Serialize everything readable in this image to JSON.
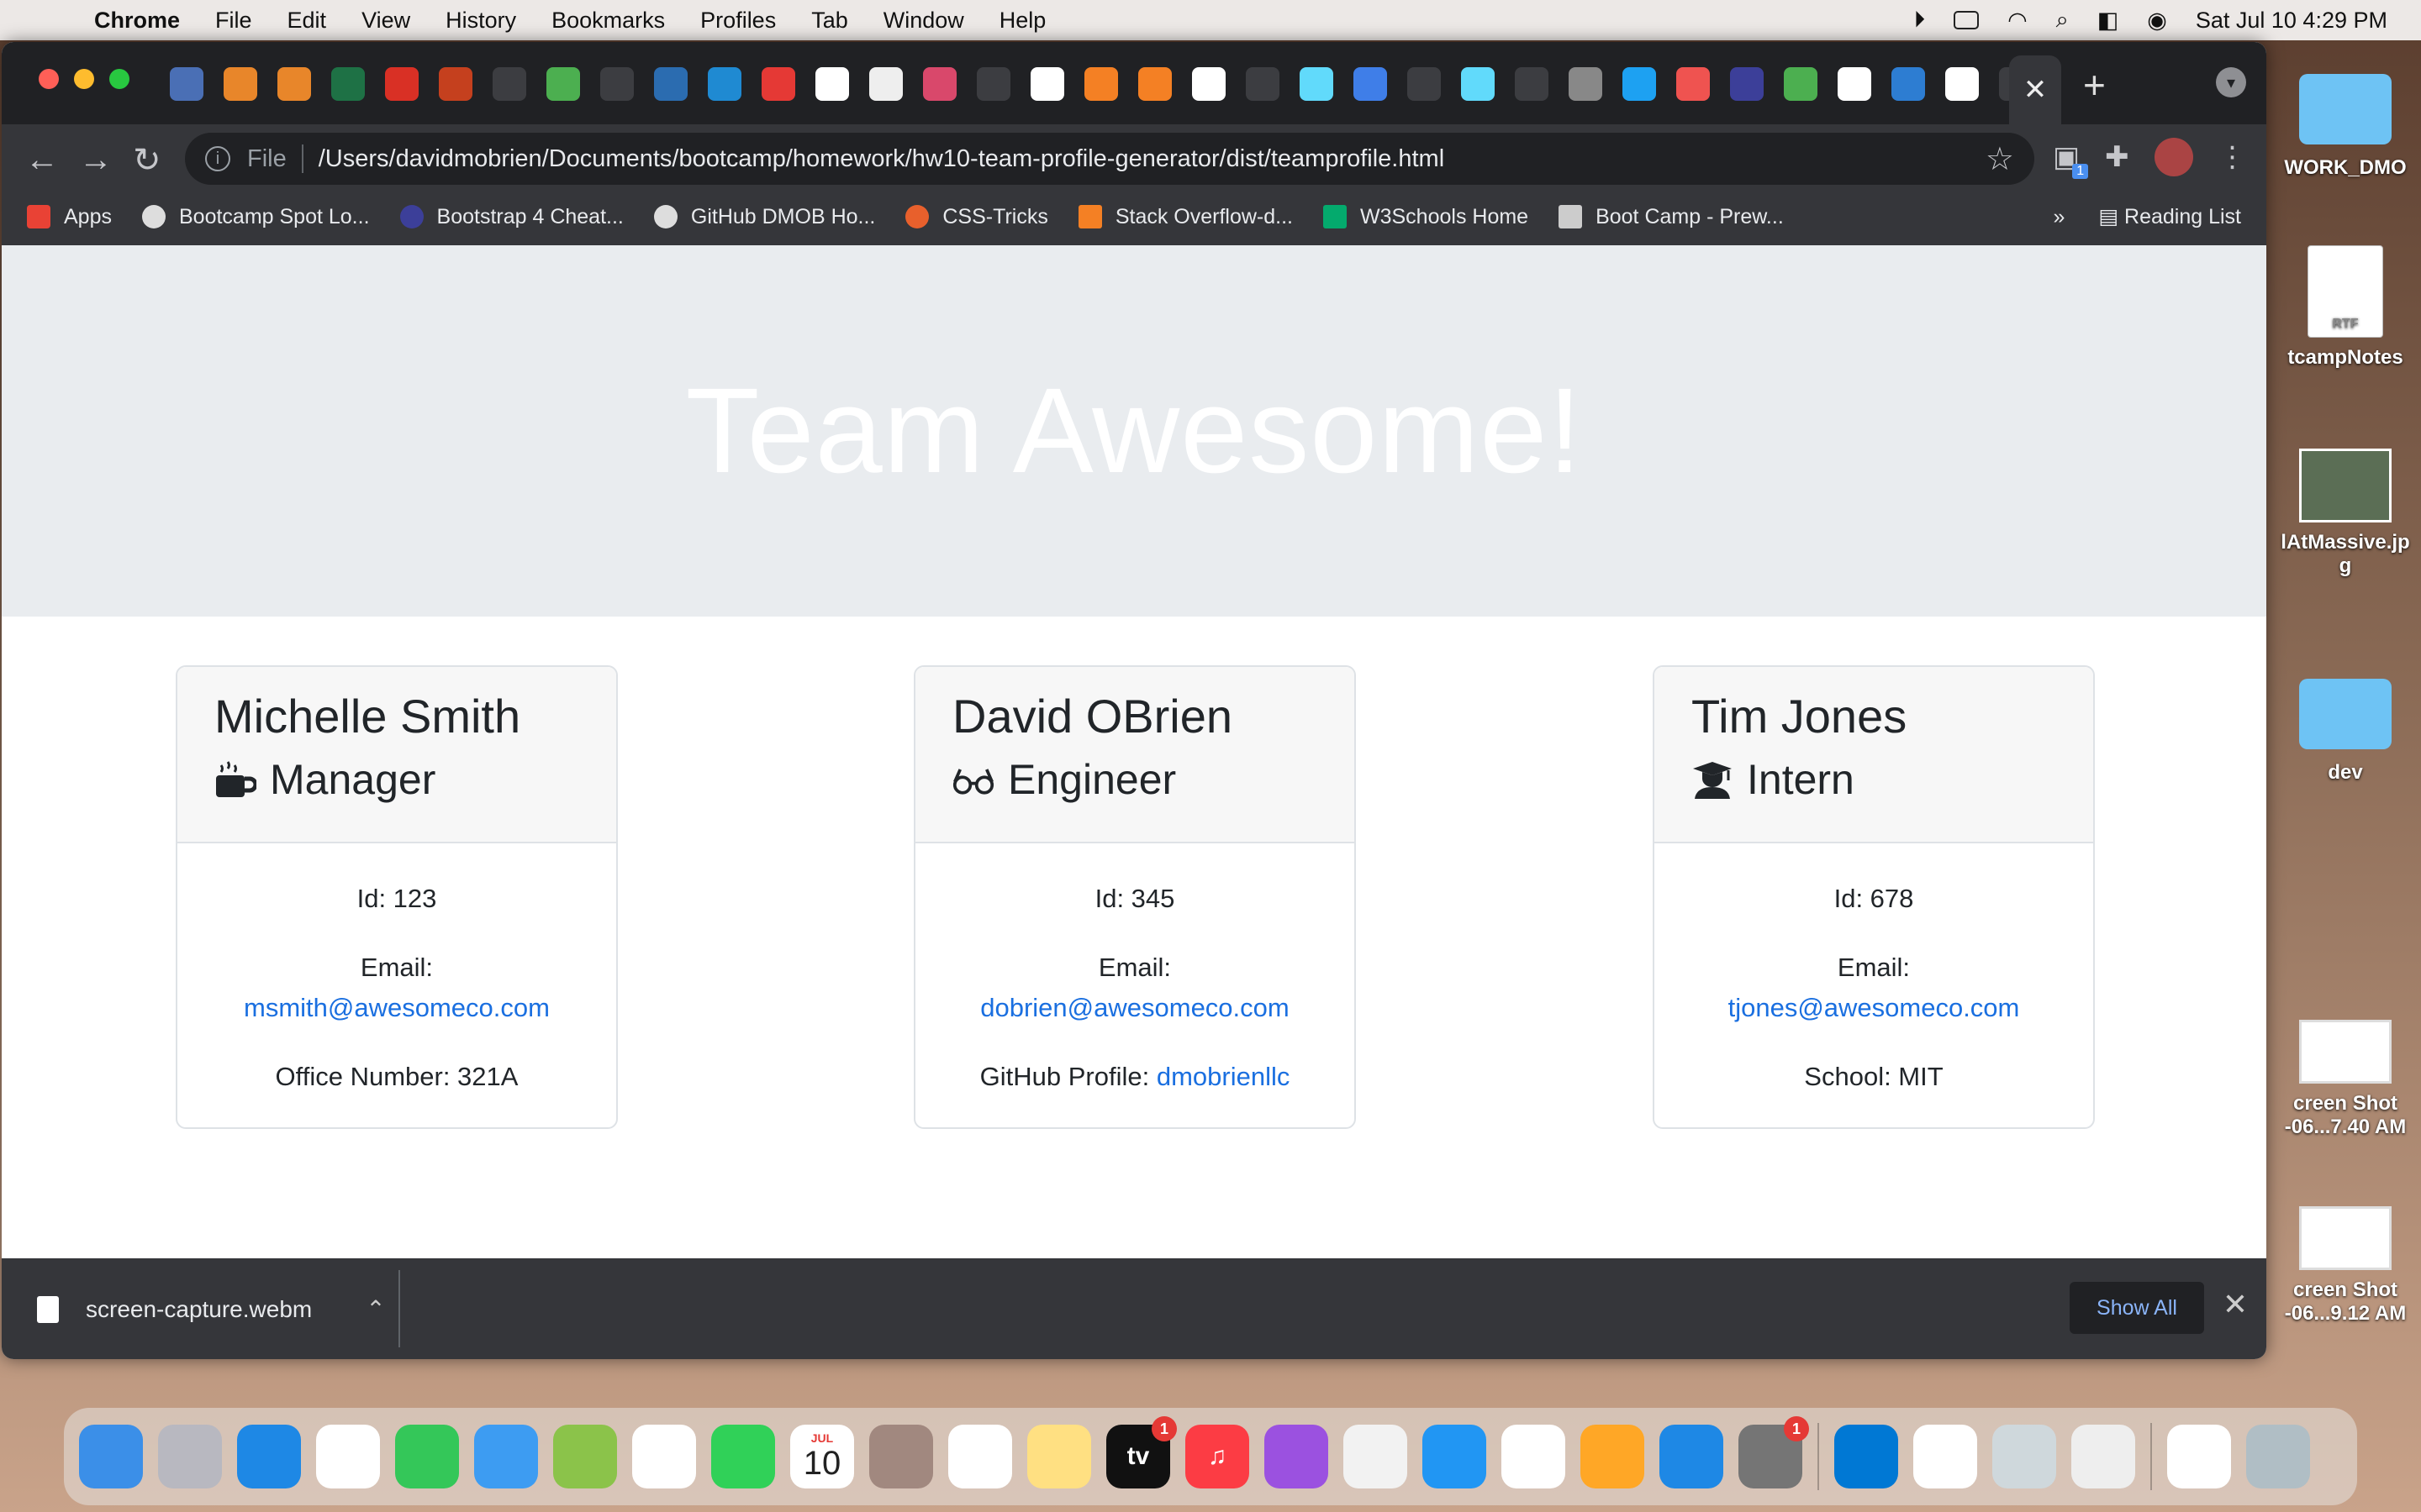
{
  "menubar": {
    "app": "Chrome",
    "items": [
      "File",
      "Edit",
      "View",
      "History",
      "Bookmarks",
      "Profiles",
      "Tab",
      "Window",
      "Help"
    ],
    "datetime": "Sat Jul 10  4:29 PM"
  },
  "desktop": {
    "icons": [
      {
        "label": "WORK_DMO"
      },
      {
        "label": "tcampNotes",
        "kind": "RTF"
      },
      {
        "label": "lAtMassive.jp g"
      },
      {
        "label": "dev"
      },
      {
        "label": "creen Shot -06...7.40 AM"
      },
      {
        "label": "creen Shot -06...9.12 AM"
      }
    ]
  },
  "browser": {
    "address": {
      "scheme_label": "File",
      "url": "/Users/davidmobrien/Documents/bootcamp/homework/hw10-team-profile-generator/dist/teamprofile.html"
    },
    "extension_badge": "1",
    "bookmarks": [
      {
        "label": "Apps",
        "color": "#e94235"
      },
      {
        "label": "Bootcamp Spot Lo...",
        "color": "#dddddd"
      },
      {
        "label": "Bootstrap 4 Cheat...",
        "color": "#3c3f99"
      },
      {
        "label": "GitHub DMOB Ho...",
        "color": "#dddddd"
      },
      {
        "label": "CSS-Tricks",
        "color": "#e8602c"
      },
      {
        "label": "Stack Overflow-d...",
        "color": "#f48024"
      },
      {
        "label": "W3Schools Home",
        "color": "#04aa6d"
      },
      {
        "label": "Boot Camp - Prew...",
        "color": "#cccccc"
      }
    ],
    "bookmarks_more": "»",
    "reading_list": "Reading List"
  },
  "page": {
    "title": "Team Awesome!",
    "cards": [
      {
        "name": "Michelle Smith",
        "role": "Manager",
        "role_icon": "coffee-mug-icon",
        "id_text": "Id: 123",
        "email_label": "Email:",
        "email": "msmith@awesomeco.com",
        "extra_label": "Office Number: 321A",
        "extra_link": ""
      },
      {
        "name": "David OBrien",
        "role": "Engineer",
        "role_icon": "glasses-icon",
        "id_text": "Id: 345",
        "email_label": "Email:",
        "email": "dobrien@awesomeco.com",
        "extra_label": "GitHub Profile: ",
        "extra_link": "dmobrienllc"
      },
      {
        "name": "Tim Jones",
        "role": "Intern",
        "role_icon": "graduate-icon",
        "id_text": "Id: 678",
        "email_label": "Email:",
        "email": "tjones@awesomeco.com",
        "extra_label": "School: MIT",
        "extra_link": ""
      }
    ]
  },
  "download_bar": {
    "filename": "screen-capture.webm",
    "show_all": "Show All"
  },
  "dock": {
    "tv_label": "tv",
    "calendar": {
      "month": "JUL",
      "day": "10"
    },
    "badges": {
      "tv": "1",
      "system_prefs": "1"
    }
  },
  "colors": {
    "link": "#1a6fe0",
    "jumbotron": "#e9ecef",
    "chrome_dark": "#202124"
  }
}
